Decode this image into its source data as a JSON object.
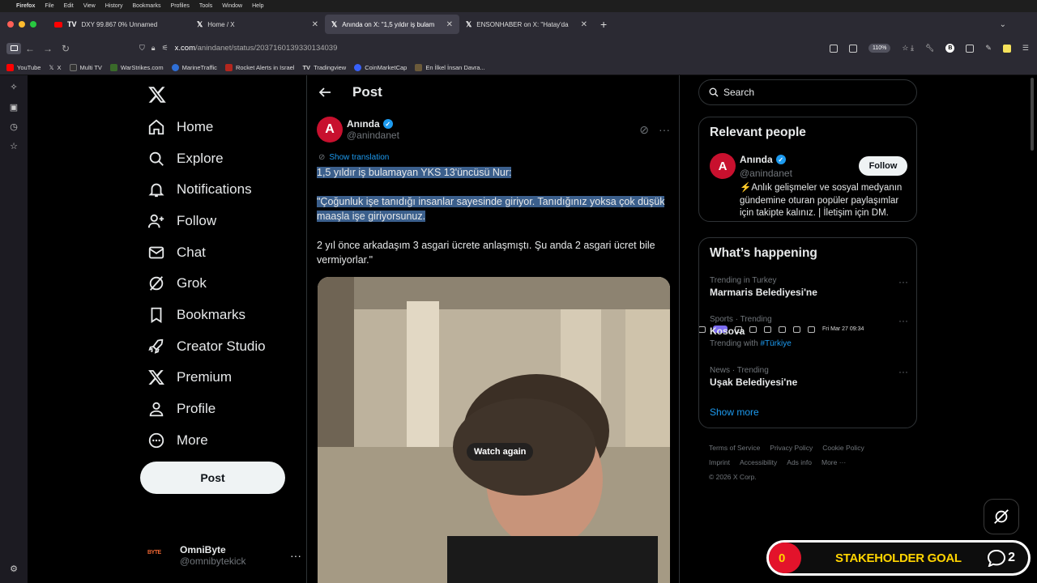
{
  "menubar": {
    "app": "Firefox",
    "items": [
      "File",
      "Edit",
      "View",
      "History",
      "Bookmarks",
      "Profiles",
      "Tools",
      "Window",
      "Help"
    ],
    "clock": "Fri Mar 27  09:34"
  },
  "tabs": [
    {
      "label": "DXY 99.867 0% Unnamed"
    },
    {
      "label": "Home / X"
    },
    {
      "label": "Anında on X: \"1,5 yıldır iş bulam"
    },
    {
      "label": "ENSONHABER on X: \"Hatay'da"
    }
  ],
  "navbar": {
    "url_host": "x.com",
    "url_path": "/anindanet/status/2037160139330134039",
    "zoom": "110%"
  },
  "bookmarks": [
    "YouTube",
    "X",
    "Multi TV",
    "WarStrikes.com",
    "MarineTraffic",
    "Rocket Alerts in Israel",
    "Tradingview",
    "CoinMarketCap",
    "En İlkel İnsan Davra..."
  ],
  "xnav": {
    "items": [
      {
        "label": "Home",
        "icon": "home-icon"
      },
      {
        "label": "Explore",
        "icon": "search-icon"
      },
      {
        "label": "Notifications",
        "icon": "bell-icon"
      },
      {
        "label": "Follow",
        "icon": "person-add-icon"
      },
      {
        "label": "Chat",
        "icon": "mail-icon"
      },
      {
        "label": "Grok",
        "icon": "grok-icon"
      },
      {
        "label": "Bookmarks",
        "icon": "bookmark-icon"
      },
      {
        "label": "Creator Studio",
        "icon": "rocket-icon"
      },
      {
        "label": "Premium",
        "icon": "x-logo-icon"
      },
      {
        "label": "Profile",
        "icon": "person-icon"
      },
      {
        "label": "More",
        "icon": "more-circle-icon"
      }
    ],
    "post_label": "Post",
    "account": {
      "avatar_text": "BYTE",
      "name": "OmniByte",
      "handle": "@omnibytekick"
    }
  },
  "post": {
    "header_title": "Post",
    "author_name": "Anında",
    "author_handle": "@anindanet",
    "avatar_letter": "A",
    "show_translation": "Show translation",
    "line1": "1,5 yıldır iş bulamayan YKS 13'üncüsü Nur:",
    "line2": "\"Çoğunluk işe tanıdığı insanlar sayesinde giriyor. Tanıdığınız yoksa çok düşük maaşla işe giriyorsunuz.",
    "line3": "2 yıl önce arkadaşım 3 asgari ücrete anlaşmıştı. Şu anda 2 asgari ücret bile vermiyorlar.\"",
    "watch_again": "Watch again"
  },
  "right": {
    "search_placeholder": "Search",
    "relevant_title": "Relevant people",
    "person": {
      "name": "Anında",
      "handle": "@anindanet",
      "follow": "Follow",
      "bio": "⚡Anlık gelişmeler ve sosyal medyanın gündemine oturan popüler paylaşımlar için takipte kalınız. | İletişim için DM."
    },
    "happening_title": "What’s happening",
    "trends": [
      {
        "meta": "Trending in Turkey",
        "name": "Marmaris Belediyesi'ne",
        "with_prefix": "",
        "with_tag": ""
      },
      {
        "meta": "Sports · Trending",
        "name": "Kosova",
        "with_prefix": "Trending with",
        "with_tag": "#Türkiye"
      },
      {
        "meta": "News · Trending",
        "name": "Uşak Belediyesi'ne",
        "with_prefix": "",
        "with_tag": ""
      }
    ],
    "show_more": "Show more",
    "footer": [
      "Terms of Service",
      "Privacy Policy",
      "Cookie Policy",
      "Imprint",
      "Accessibility",
      "Ads info",
      "More ···",
      "© 2026 X Corp."
    ]
  },
  "overlay": {
    "goal_count": "0",
    "goal_label": "STAKEHOLDER GOAL",
    "comment_count": "2"
  }
}
